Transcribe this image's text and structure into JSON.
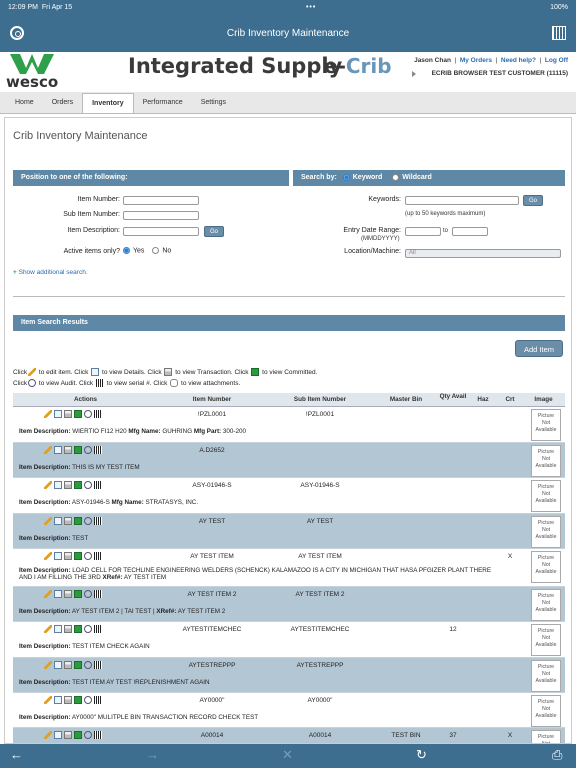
{
  "status": {
    "time": "12:09 PM",
    "date": "Fri Apr 15",
    "battery": "100%"
  },
  "nav": {
    "title": "Crib Inventory Maintenance"
  },
  "header": {
    "logo": "wesco",
    "brand": "Integrated Supply",
    "product_prefix": "e-",
    "product_suffix": "Crib",
    "user": "Jason Chan",
    "my_orders": "My Orders",
    "need_help": "Need help?",
    "log_off": "Log Off",
    "customer": "ECRIB BROWSER TEST CUSTOMER (11115)"
  },
  "tabs": [
    "Home",
    "Orders",
    "Inventory",
    "Performance",
    "Settings"
  ],
  "page_title": "Crib Inventory Maintenance",
  "position_section": {
    "title": "Position to one of the following:",
    "item_number": "Item Number:",
    "sub_item_number": "Sub Item Number:",
    "item_description": "Item Description:",
    "go": "Go",
    "active_only": "Active items only?",
    "yes": "Yes",
    "no": "No",
    "show_more": "Show additional search."
  },
  "search_section": {
    "search_by": "Search by:",
    "keyword": "Keyword",
    "wildcard": "Wildcard",
    "keywords_label": "Keywords:",
    "go": "Go",
    "keywords_hint": "(up to 50 keywords maximum)",
    "entry_date": "Entry Date Range:",
    "date_format": "(MMDDYYYY)",
    "to": "to",
    "location": "Location/Machine:",
    "location_value": "All"
  },
  "results": {
    "title": "Item Search Results",
    "add_item": "Add Item",
    "help1": [
      " to edit item. Click ",
      " to view Details. Click ",
      " to view Transaction. Click ",
      " to view Committed."
    ],
    "help2": [
      " to view Audit. Click ",
      " to view serial #. Click ",
      " to view attachments."
    ],
    "click": "Click",
    "columns": [
      "Actions",
      "Item Number",
      "Sub Item Number",
      "Master Bin",
      "Qty Avail",
      "Haz",
      "Crt",
      "Image"
    ],
    "picture_text": [
      "Picture",
      "Not",
      "Available"
    ],
    "rows": [
      {
        "item": "!PZL0001",
        "sub": "!PZL0001",
        "bin": "",
        "qty": "",
        "haz": "",
        "crt": "",
        "desc_label": "Item Description:",
        "desc": "WIERTIO FI12 H20",
        "mfg_label": "Mfg Name:",
        "mfg": "GUHRING",
        "part_label": "Mfg Part:",
        "part": "300-200"
      },
      {
        "item": "A.D2652",
        "sub": "",
        "bin": "",
        "qty": "",
        "haz": "",
        "crt": "",
        "desc_label": "Item Description:",
        "desc": "THIS IS MY TEST ITEM"
      },
      {
        "item": "ASY-01946-S",
        "sub": "ASY-01946-S",
        "bin": "",
        "qty": "",
        "haz": "",
        "crt": "",
        "desc_label": "Item Description:",
        "desc": "ASY-01946-S",
        "mfg_label": "Mfg Name:",
        "mfg": "STRATASYS, INC."
      },
      {
        "item": "AY TEST",
        "sub": "AY TEST",
        "bin": "",
        "qty": "",
        "haz": "",
        "crt": "",
        "desc_label": "Item Description:",
        "desc": "TEST"
      },
      {
        "item": "AY TEST ITEM",
        "sub": "AY TEST ITEM",
        "bin": "",
        "qty": "",
        "haz": "",
        "crt": "X",
        "desc_label": "Item Description:",
        "desc": "LOAD CELL FOR TECHLINE ENGINEERING WELDERS (SCHENCK) KALAMAZOO IS A CITY IN MICHIGAN THAT HASA PFGIZER PLANT THERE",
        "desc2": "AND I AM FILLING THE 3RD",
        "xref_label": "XRef#:",
        "xref": "AY TEST ITEM"
      },
      {
        "item": "AY TEST ITEM 2",
        "sub": "AY TEST ITEM 2",
        "bin": "",
        "qty": "",
        "haz": "",
        "crt": "",
        "desc_label": "Item Description:",
        "desc": "AY TEST ITEM 2 | TAI TEST |",
        "xref_label": "XRef#:",
        "xref": "AY TEST ITEM 2"
      },
      {
        "item": "AYTESTITEMCHEC",
        "sub": "AYTESTITEMCHEC",
        "bin": "",
        "qty": "12",
        "haz": "",
        "crt": "",
        "desc_label": "Item Description:",
        "desc": "TEST ITEM CHECK AGAIN"
      },
      {
        "item": "AYTESTREPPP",
        "sub": "AYTESTREPPP",
        "bin": "",
        "qty": "",
        "haz": "",
        "crt": "",
        "desc_label": "Item Description:",
        "desc": "TEST ITEM AY TEST !REPLENISHMENT AGAIN"
      },
      {
        "item": "AY0000\"",
        "sub": "AY0000\"",
        "bin": "",
        "qty": "",
        "haz": "",
        "crt": "",
        "desc_label": "Item Description:",
        "desc": "AY0000\" MULITPLE BIN TRANSACTION RECORD CHECK TEST"
      },
      {
        "item": "A00014",
        "sub": "A00014",
        "bin": "TEST BIN",
        "qty": "37",
        "haz": "",
        "crt": "X",
        "desc_label": "",
        "desc": ""
      }
    ]
  },
  "toolbar": {
    "back": "←",
    "forward": "→",
    "stop": "✕",
    "reload": "↻",
    "print": "⎙"
  },
  "colors": {
    "bar": "#3d6e8f",
    "section": "#5e88a6",
    "alt_row": "#b3c6d3",
    "link": "#2a6bb0"
  }
}
